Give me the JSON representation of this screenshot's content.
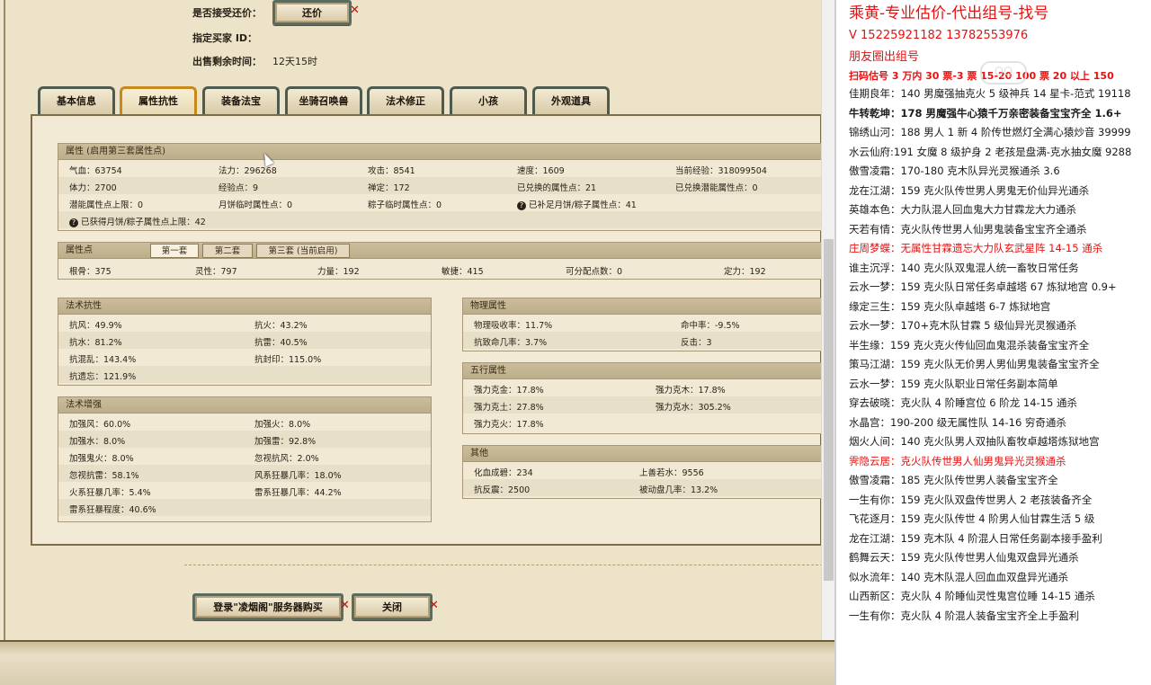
{
  "header": {
    "accept_counter_label": "是否接受还价：",
    "counter_button": "还价",
    "buyer_id_label": "指定买家 ID：",
    "time_left_label": "出售剩余时间：",
    "time_left_value": "12天15时"
  },
  "tabs": [
    "基本信息",
    "属性抗性",
    "装备法宝",
    "坐骑召唤兽",
    "法术修正",
    "小孩",
    "外观道具"
  ],
  "active_tab": "属性抗性",
  "attributes": {
    "title": "属性 (启用第三套属性点)",
    "rows": [
      [
        "气血：63754",
        "法力：296268",
        "攻击：8541",
        "速度：1609",
        "当前经验：318099504"
      ],
      [
        "体力：2700",
        "经验点：9",
        "禅定：172",
        "已兑换的属性点：21",
        "已兑换潜能属性点：0"
      ],
      [
        "潜能属性点上限：0",
        "月饼临时属性点：0",
        "粽子临时属性点：0",
        "已补足月饼/粽子属性点：41",
        ""
      ]
    ],
    "footer": "已获得月饼/粽子属性点上限：42"
  },
  "points": {
    "title": "属性点",
    "subtabs": [
      "第一套",
      "第二套",
      "第三套 (当前启用)"
    ],
    "values": [
      "根骨：375",
      "灵性：797",
      "力量：192",
      "敏捷：415",
      "可分配点数：0",
      "定力：192"
    ]
  },
  "spell_resist": {
    "title": "法术抗性",
    "rows": [
      [
        "抗风：49.9%",
        "抗火：43.2%"
      ],
      [
        "抗水：81.2%",
        "抗雷：40.5%"
      ],
      [
        "抗混乱：143.4%",
        "抗封印：115.0%"
      ],
      [
        "抗遗忘：121.9%",
        ""
      ]
    ]
  },
  "spell_boost": {
    "title": "法术增强",
    "rows": [
      [
        "加强风：60.0%",
        "加强火：8.0%"
      ],
      [
        "加强水：8.0%",
        "加强雷：92.8%"
      ],
      [
        "加强鬼火：8.0%",
        "忽视抗风：2.0%"
      ],
      [
        "忽视抗雷：58.1%",
        "风系狂暴几率：18.0%"
      ],
      [
        "火系狂暴几率：5.4%",
        "雷系狂暴几率：44.2%"
      ],
      [
        "雷系狂暴程度：40.6%",
        ""
      ]
    ]
  },
  "physical": {
    "title": "物理属性",
    "rows": [
      [
        "物理吸收率：11.7%",
        "命中率：-9.5%"
      ],
      [
        "抗致命几率：3.7%",
        "反击：3"
      ]
    ]
  },
  "five_elements": {
    "title": "五行属性",
    "rows": [
      [
        "强力克金：17.8%",
        "强力克木：17.8%"
      ],
      [
        "强力克土：27.8%",
        "强力克水：305.2%"
      ],
      [
        "强力克火：17.8%",
        ""
      ]
    ]
  },
  "other": {
    "title": "其他",
    "rows": [
      [
        "化血成碧：234",
        "上善若水：9556"
      ],
      [
        "抗反震：2500",
        "被动盘几率：13.2%"
      ]
    ]
  },
  "buttons": {
    "buy": "登录\"凌烟阁\"服务器购买",
    "close": "关闭"
  },
  "right_panel": {
    "title": "乘黄-专业估价-代出组号-找号",
    "contact": "V    15225921182    13782553976",
    "moments": "朋友圈出组号",
    "promo": "扫码估号 3 万内 30 票-3   票    15-20 100 票  20 以上 150",
    "lines": [
      {
        "text": "佳期良年：140 男魔强抽克火 5 级神兵 14 星卡-范式 19118",
        "style": ""
      },
      {
        "text": "牛转乾坤：178 男魔强牛心猿千万亲密装备宝宝齐全 1.6+",
        "style": "bold"
      },
      {
        "text": "锦绣山河：188 男人 1 新 4 阶传世燃灯全满心猿炒音 39999",
        "style": ""
      },
      {
        "text": "水云仙府:191 女魔 8 级护身 2 老孩是盘满-克水抽女魔 9288",
        "style": ""
      },
      {
        "text": "傲雪凌霜：170-180 克木队异光灵猴通杀 3.6",
        "style": ""
      },
      {
        "text": "龙在江湖：159 克火队传世男人男鬼无价仙异光通杀",
        "style": ""
      },
      {
        "text": "英雄本色：大力队混人回血鬼大力甘霖龙大力通杀",
        "style": ""
      },
      {
        "text": "天若有情：克火队传世男人仙男鬼装备宝宝齐全通杀",
        "style": ""
      },
      {
        "text": "庄周梦蝶：无属性甘霖遗忘大力队玄武星阵 14-15 通杀",
        "style": "red"
      },
      {
        "text": "谁主沉浮：140 克火队双鬼混人统一畜牧日常任务",
        "style": ""
      },
      {
        "text": "云水一梦：159 克火队日常任务卓越塔 67 炼狱地宫 0.9+",
        "style": ""
      },
      {
        "text": "缘定三生：159 克火队卓越塔 6-7 炼狱地宫",
        "style": ""
      },
      {
        "text": "云水一梦：170+克木队甘霖 5 级仙异光灵猴通杀",
        "style": ""
      },
      {
        "text": "半生缘：159 克火克火传仙回血鬼混杀装备宝宝齐全",
        "style": ""
      },
      {
        "text": "策马江湖：159 克火队无价男人男仙男鬼装备宝宝齐全",
        "style": ""
      },
      {
        "text": "云水一梦：159 克火队职业日常任务副本简单",
        "style": ""
      },
      {
        "text": "穿去破晓：克火队 4 阶睡宫位 6 阶龙 14-15 通杀",
        "style": ""
      },
      {
        "text": "水晶宫：190-200 级无属性队 14-16 穷奇通杀",
        "style": ""
      },
      {
        "text": "烟火人间：140 克火队男人双抽队畜牧卓越塔炼狱地宫",
        "style": ""
      },
      {
        "text": "霁隐云居：克火队传世男人仙男鬼异光灵猴通杀",
        "style": "red"
      },
      {
        "text": "傲雪凌霜：185 克火队传世男人装备宝宝齐全",
        "style": ""
      },
      {
        "text": "一生有你：159 克火队双盘传世男人 2 老孩装备齐全",
        "style": ""
      },
      {
        "text": "飞花逐月：159 克火队传世 4 阶男人仙甘霖生活 5 级",
        "style": ""
      },
      {
        "text": "龙在江湖：159 克木队 4 阶混人日常任务副本接手盈利",
        "style": ""
      },
      {
        "text": "鹤舞云天：159 克火队传世男人仙鬼双盘异光通杀",
        "style": ""
      },
      {
        "text": "似水流年：140 克木队混人回血血双盘异光通杀",
        "style": ""
      },
      {
        "text": "山西新区：克火队 4 阶睡仙灵性鬼宫位睡 14-15 通杀",
        "style": ""
      },
      {
        "text": "一生有你：克火队 4 阶混人装备宝宝齐全上手盈利",
        "style": ""
      }
    ]
  },
  "watermark": "QQ"
}
